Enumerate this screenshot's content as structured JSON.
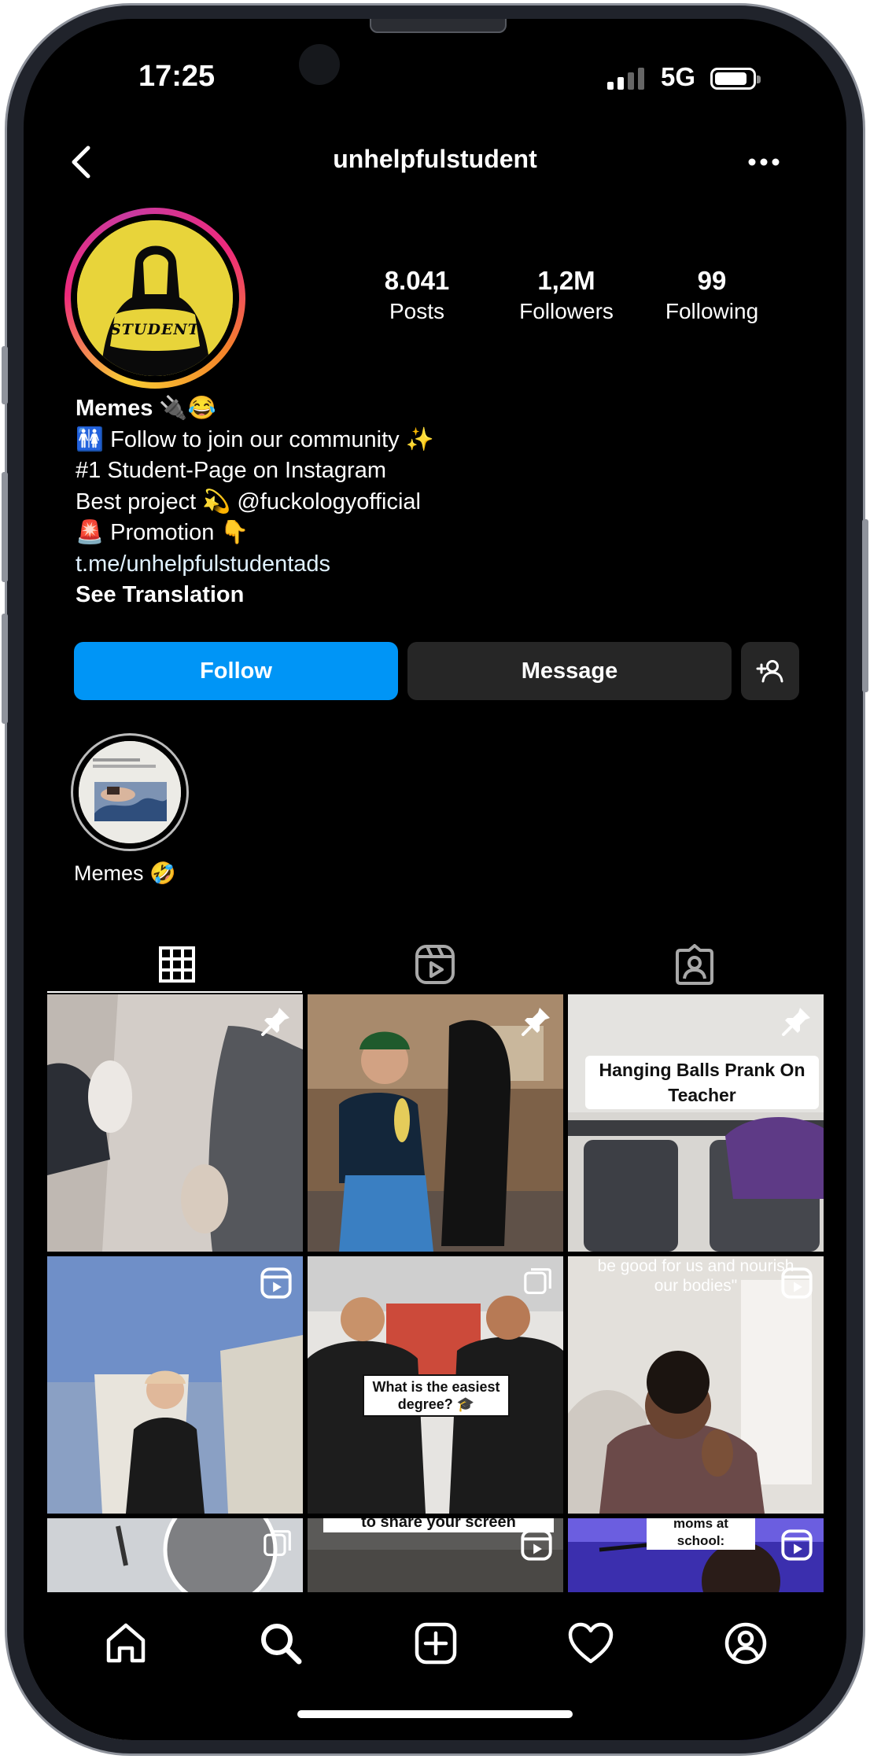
{
  "status_bar": {
    "time": "17:25",
    "network": "5G"
  },
  "header": {
    "username": "unhelpfulstudent"
  },
  "profile": {
    "avatar_text": "STUDENT",
    "stats": [
      {
        "value": "8.041",
        "label": "Posts"
      },
      {
        "value": "1,2M",
        "label": "Followers"
      },
      {
        "value": "99",
        "label": "Following"
      }
    ],
    "bio": {
      "name": "Memes 🔌😂",
      "lines": [
        "🚻 Follow to join our community ✨",
        "#1 Student-Page on Instagram",
        "Best project 💫 @fuckologyofficial",
        "🚨 Promotion 👇"
      ],
      "link": "t.me/unhelpfulstudentads",
      "translate": "See Translation"
    }
  },
  "actions": {
    "follow": "Follow",
    "message": "Message"
  },
  "highlights": [
    {
      "label": "Memes 🤣"
    }
  ],
  "tabs": [
    "grid-icon",
    "reels-icon",
    "tagged-icon"
  ],
  "posts": [
    {
      "badge": "pin-icon",
      "caption": ""
    },
    {
      "badge": "pin-icon",
      "caption": ""
    },
    {
      "badge": "pin-icon",
      "caption": "Hanging Balls Prank On Teacher"
    },
    {
      "badge": "reel-icon",
      "caption": ""
    },
    {
      "badge": "carousel-icon",
      "caption": "What is the easiest degree? 🎓"
    },
    {
      "badge": "reel-icon",
      "caption": "be good for us and nourish our bodies\""
    },
    {
      "badge": "carousel-icon",
      "caption": ""
    },
    {
      "badge": "reel-icon",
      "caption": "to share your screen"
    },
    {
      "badge": "reel-icon",
      "caption": "moms at school:"
    }
  ],
  "bottom_nav": [
    "home-icon",
    "search-icon",
    "create-icon",
    "heart-icon",
    "profile-icon"
  ],
  "colors": {
    "follow": "#0095f6",
    "secondary_button": "#262626",
    "background": "#000000"
  }
}
